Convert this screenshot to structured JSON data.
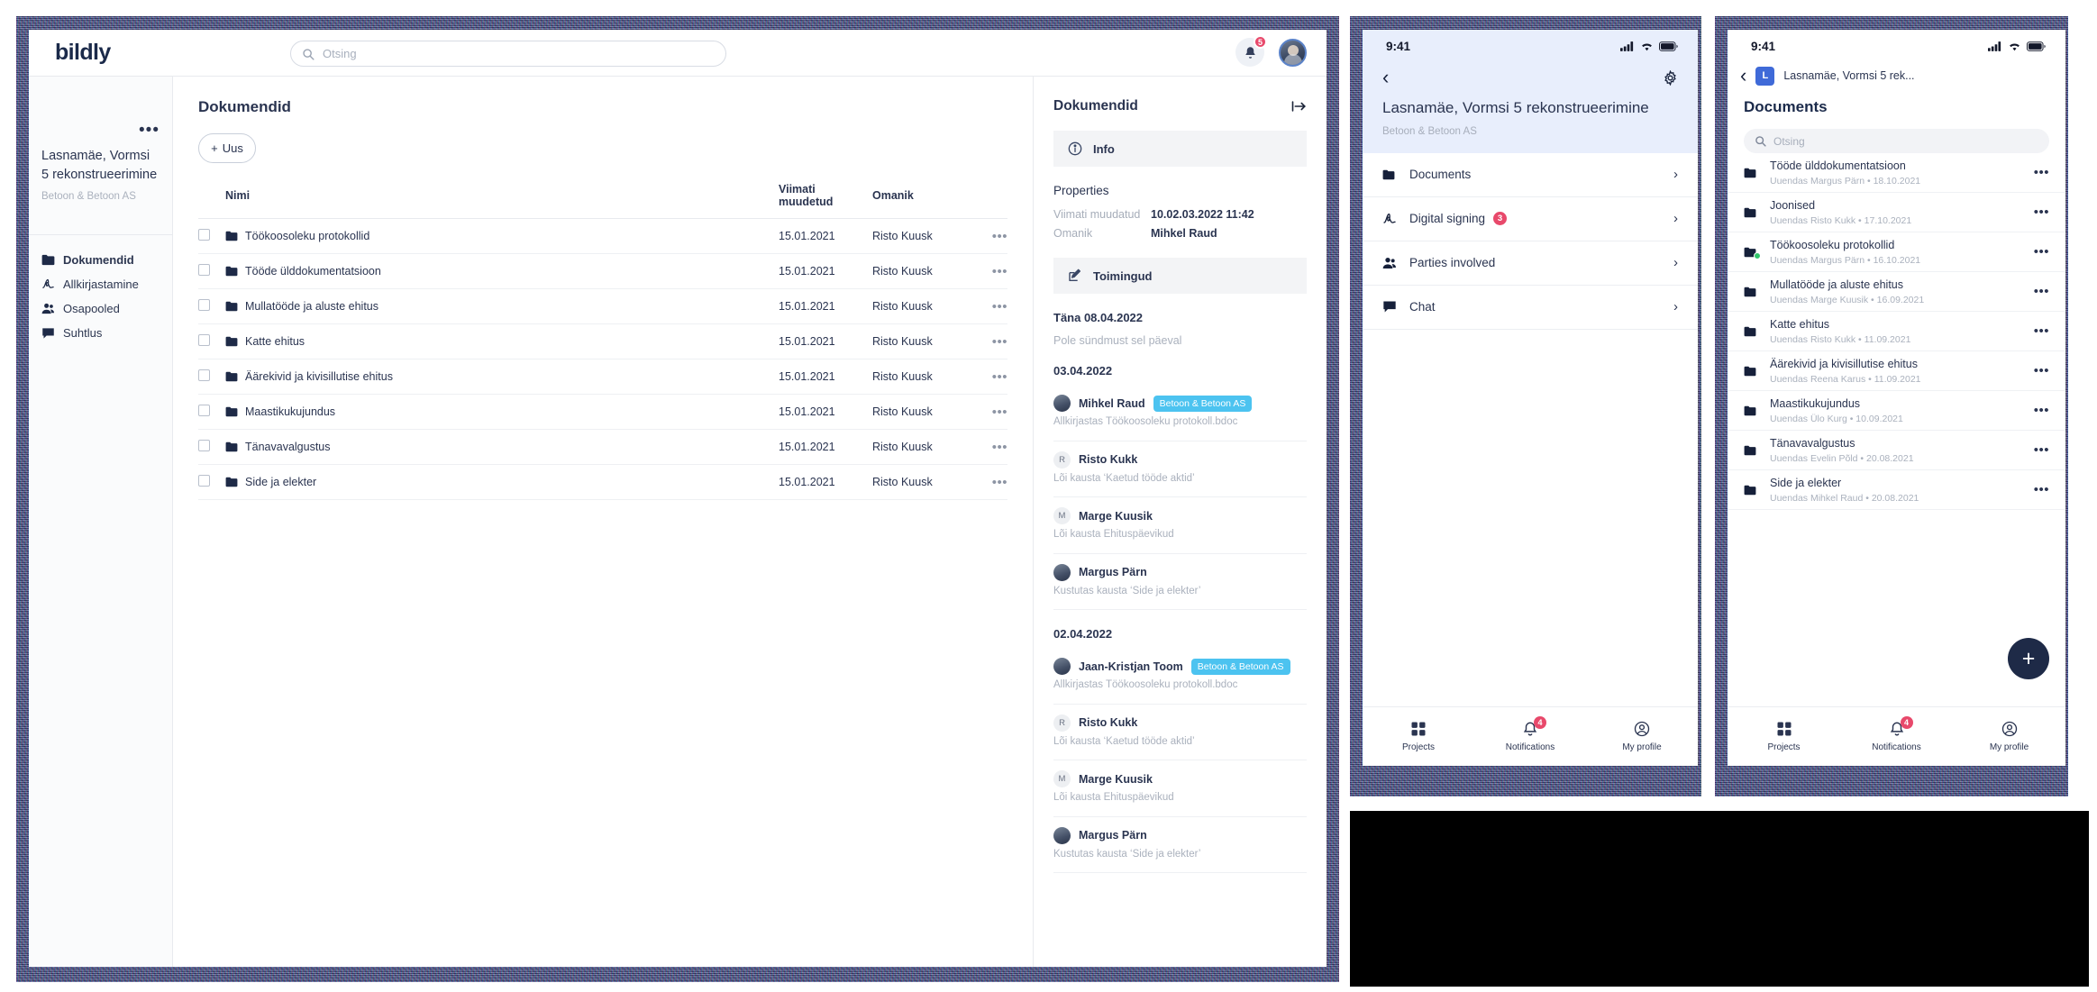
{
  "desktop": {
    "brand": "bildly",
    "search": {
      "placeholder": "Otsing",
      "value": ""
    },
    "notifications_count": "5",
    "sidebar": {
      "project_title": "Lasnamäe, Vormsi 5 rekonstrueerimine",
      "project_company": "Betoon & Betoon AS",
      "menu_dots": "•••",
      "items": [
        {
          "label": "Dokumendid",
          "icon": "folder-icon",
          "active": true
        },
        {
          "label": "Allkirjastamine",
          "icon": "signature-icon",
          "active": false
        },
        {
          "label": "Osapooled",
          "icon": "people-icon",
          "active": false
        },
        {
          "label": "Suhtlus",
          "icon": "chat-icon",
          "active": false
        }
      ]
    },
    "main": {
      "title": "Dokumendid",
      "new_button": "Uus",
      "new_button_plus": "+",
      "columns": {
        "check": "",
        "name": "Nimi",
        "modified": "Viimati muudetud",
        "owner": "Omanik",
        "actions": ""
      },
      "rows": [
        {
          "name": "Töökoosoleku protokollid",
          "modified": "15.01.2021",
          "owner": "Risto Kuusk"
        },
        {
          "name": "Tööde ülddokumentatsioon",
          "modified": "15.01.2021",
          "owner": "Risto Kuusk"
        },
        {
          "name": "Mullatööde ja aluste ehitus",
          "modified": "15.01.2021",
          "owner": "Risto Kuusk"
        },
        {
          "name": "Katte ehitus",
          "modified": "15.01.2021",
          "owner": "Risto Kuusk"
        },
        {
          "name": "Äärekivid ja kivisillutise ehitus",
          "modified": "15.01.2021",
          "owner": "Risto Kuusk"
        },
        {
          "name": "Maastikukujundus",
          "modified": "15.01.2021",
          "owner": "Risto Kuusk"
        },
        {
          "name": "Tänavavalgustus",
          "modified": "15.01.2021",
          "owner": "Risto Kuusk"
        },
        {
          "name": "Side ja elekter",
          "modified": "15.01.2021",
          "owner": "Risto Kuusk"
        }
      ],
      "row_dots": "•••"
    },
    "panel": {
      "title": "Dokumendid",
      "tab_info": "Info",
      "properties_heading": "Properties",
      "prop_modified_key": "Viimati muudatud",
      "prop_modified_value": "10.02.03.2022 11:42",
      "prop_owner_key": "Omanik",
      "prop_owner_value": "Mihkel Raud",
      "tab_actions": "Toimingud",
      "groups": [
        {
          "day": "Täna 08.04.2022",
          "empty": "Pole sündmust sel päeval",
          "events": []
        },
        {
          "day": "03.04.2022",
          "empty": "",
          "events": [
            {
              "avatar": "photo",
              "initial": "",
              "name": "Mihkel Raud",
              "chip": "Betoon & Betoon AS",
              "desc": "Allkirjastas Töökoosoleku protokoll.bdoc"
            },
            {
              "avatar": "initial",
              "initial": "R",
              "name": "Risto Kukk",
              "chip": "",
              "desc": "Lõi kausta ‘Kaetud tööde aktid’"
            },
            {
              "avatar": "initial",
              "initial": "M",
              "name": "Marge Kuusik",
              "chip": "",
              "desc": "Lõi kausta Ehituspäevikud"
            },
            {
              "avatar": "photo",
              "initial": "",
              "name": "Margus Pärn",
              "chip": "",
              "desc": "Kustutas kausta ‘Side ja elekter’"
            }
          ]
        },
        {
          "day": "02.04.2022",
          "empty": "",
          "events": [
            {
              "avatar": "photo",
              "initial": "",
              "name": "Jaan-Kristjan Toom",
              "chip": "Betoon & Betoon AS",
              "desc": "Allkirjastas Töökoosoleku protokoll.bdoc"
            },
            {
              "avatar": "initial",
              "initial": "R",
              "name": "Risto Kukk",
              "chip": "",
              "desc": "Lõi kausta ‘Kaetud tööde aktid’"
            },
            {
              "avatar": "initial",
              "initial": "M",
              "name": "Marge Kuusik",
              "chip": "",
              "desc": "Lõi kausta Ehituspäevikud"
            },
            {
              "avatar": "photo",
              "initial": "",
              "name": "Margus Pärn",
              "chip": "",
              "desc": "Kustutas kausta ‘Side ja elekter’"
            }
          ]
        }
      ]
    }
  },
  "phone1": {
    "status_time": "9:41",
    "back": "‹",
    "title": "Lasnamäe, Vormsi 5 rekonstrueerimine",
    "company": "Betoon & Betoon AS",
    "rows": [
      {
        "label": "Documents",
        "icon": "folder-icon",
        "badge": ""
      },
      {
        "label": "Digital signing",
        "icon": "signature-icon",
        "badge": "3"
      },
      {
        "label": "Parties involved",
        "icon": "people-icon",
        "badge": ""
      },
      {
        "label": "Chat",
        "icon": "chat-icon",
        "badge": ""
      }
    ],
    "chevron": "›",
    "tabs": [
      {
        "label": "Projects",
        "icon": "grid-icon",
        "badge": ""
      },
      {
        "label": "Notifications",
        "icon": "bell-icon",
        "badge": "4"
      },
      {
        "label": "My profile",
        "icon": "profile-icon",
        "badge": ""
      }
    ]
  },
  "phone2": {
    "status_time": "9:41",
    "back": "‹",
    "avatar_initial": "L",
    "breadcrumb": "Lasnamäe, Vormsi 5 rek...",
    "heading": "Documents",
    "search_placeholder": "Otsing",
    "fab": "+",
    "row_dots": "•••",
    "rows": [
      {
        "name": "Tööde ülddokumentatsioon",
        "meta": "Uuendas Margus Pärn • 18.10.2021",
        "shared": false
      },
      {
        "name": "Joonised",
        "meta": "Uuendas Risto Kukk • 17.10.2021",
        "shared": false
      },
      {
        "name": "Töökoosoleku protokollid",
        "meta": "Uuendas Margus Pärn • 16.10.2021",
        "shared": true
      },
      {
        "name": "Mullatööde ja aluste ehitus",
        "meta": "Uuendas Marge Kuusik • 16.09.2021",
        "shared": false
      },
      {
        "name": "Katte ehitus",
        "meta": "Uuendas Risto Kukk • 11.09.2021",
        "shared": false
      },
      {
        "name": "Äärekivid ja kivisillutise ehitus",
        "meta": "Uuendas Reena Karus • 11.09.2021",
        "shared": false
      },
      {
        "name": "Maastikukujundus",
        "meta": "Uuendas Ülo Kurg • 10.09.2021",
        "shared": false
      },
      {
        "name": "Tänavavalgustus",
        "meta": "Uuendas Evelin Põld • 20.08.2021",
        "shared": false
      },
      {
        "name": "Side ja elekter",
        "meta": "Uuendas Mihkel Raud • 20.08.2021",
        "shared": false
      }
    ],
    "tabs": [
      {
        "label": "Projects",
        "icon": "grid-icon",
        "badge": ""
      },
      {
        "label": "Notifications",
        "icon": "bell-icon",
        "badge": "4"
      },
      {
        "label": "My profile",
        "icon": "profile-icon",
        "badge": ""
      }
    ]
  },
  "colors": {
    "brand_navy": "#1b2a4a",
    "accent_cyan": "#4cc3f0",
    "badge_pink": "#e8496b",
    "phone_header": "#e8eefc"
  }
}
